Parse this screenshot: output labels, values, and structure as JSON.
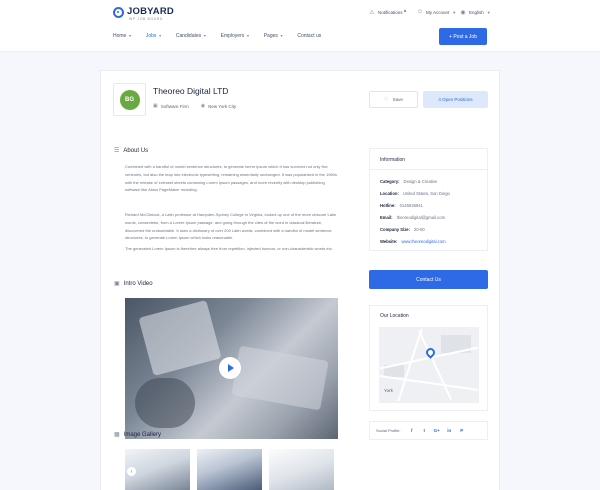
{
  "header": {
    "logo_text": "JOBYARD",
    "logo_tagline": "WP JOB BOARD",
    "notifications_label": "Notifications",
    "account_label": "My Account",
    "language_label": "English",
    "nav": [
      {
        "label": "Home"
      },
      {
        "label": "Jobs"
      },
      {
        "label": "Candidates"
      },
      {
        "label": "Employers"
      },
      {
        "label": "Pages"
      },
      {
        "label": "Contact us"
      }
    ],
    "post_job_label": "+ Post a Job"
  },
  "company": {
    "logo_text": "BG",
    "name": "Theoreo Digital LTD",
    "type": "Software Firm",
    "location": "New York City",
    "save_label": "Save",
    "open_positions_label": "4 Open Positions"
  },
  "about": {
    "title": "About Us",
    "paragraphs": [
      "Combined with a handful of model sentence structures, to generate lorem Ipsum which It has survived not only five centuries, but also the leap into electronic typesetting, remaining essentially unchanged. It was popularised in the 1960s with the release of Letraset sheets containing Lorem Ipsum passages, and more recently with desktop publishing software like Aldus PageMaker including.",
      "Richard McClintock, a Latin professor at Hampden-Sydney College in Virginia, looked up one of the more obscure Latin words, consectetur, from a Lorem Ipsum passage, and going through the cites of the word in classical literature, discovered the undoubtable. It uses a dictionary of over 200 Latin words, combined with a handful of model sentence structures, to generate Lorem Ipsum which looks reasonable.",
      "The generated Lorem Ipsum is therefore always free from repetition, injected humour, or non-characteristic words etc."
    ]
  },
  "video": {
    "title": "Intro Video"
  },
  "gallery": {
    "title": "Image Gallery"
  },
  "info": {
    "title": "Information",
    "rows": [
      {
        "key": "Category:",
        "value": "Design & Creative"
      },
      {
        "key": "Location:",
        "value": "United States, San Diego"
      },
      {
        "key": "Hotline:",
        "value": "0145636941"
      },
      {
        "key": "Email:",
        "value": "theoreodigital@gmail.com"
      },
      {
        "key": "Company Size:",
        "value": "20-50"
      },
      {
        "key": "Website:",
        "value": "www.theoreodigital.com"
      }
    ]
  },
  "contact_label": "Contact Us",
  "location": {
    "title": "Our Location",
    "map_label": "York"
  },
  "social": {
    "label": "Social Profile:",
    "icons": [
      "f",
      "t",
      "G+",
      "in",
      "P"
    ]
  },
  "colors": {
    "accent": "#2e6ae6",
    "logo_green": "#6aa842"
  }
}
